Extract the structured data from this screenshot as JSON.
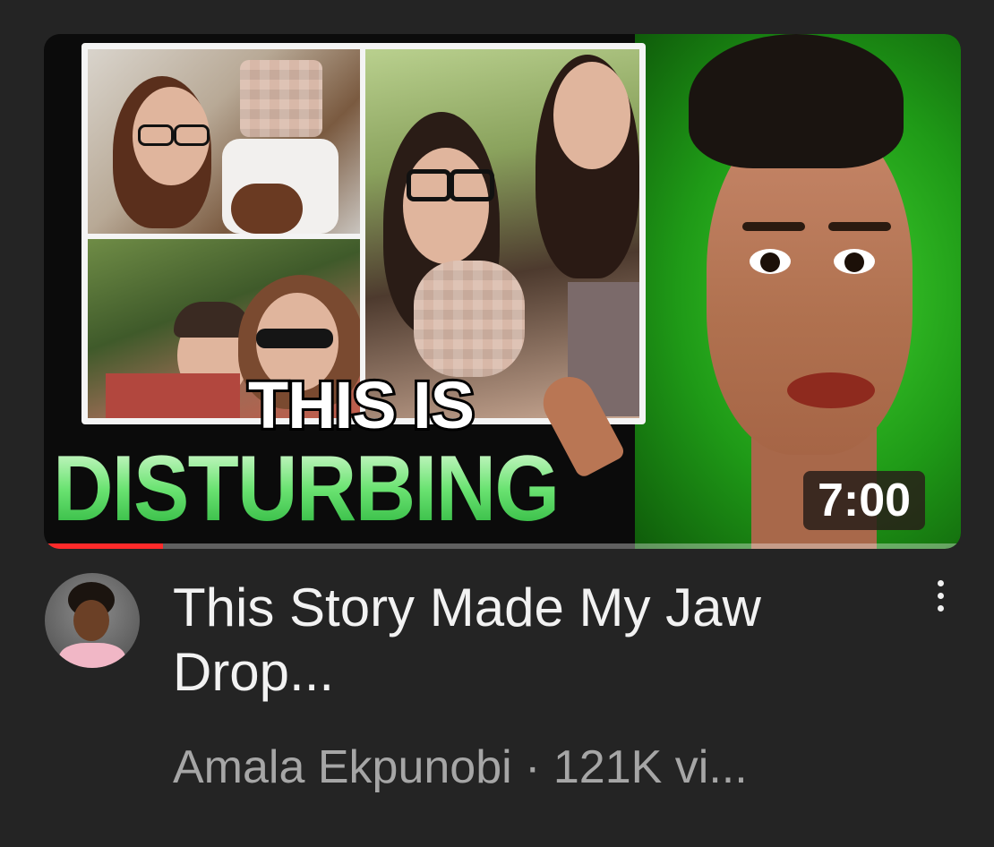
{
  "video": {
    "thumbnail": {
      "headline_line1": "THIS IS",
      "headline_line2": "DISTURBING",
      "duration": "7:00",
      "watch_progress": 0.13
    },
    "title": "This Story Made My Jaw Drop...",
    "meta": "Amala Ekpunobi · 121K vi...",
    "channel_avatar_icon": "channel-avatar",
    "menu_icon": "more-vert-icon"
  },
  "colors": {
    "background": "#242424",
    "headline_green": "#4bd65e",
    "progress_red": "#ff2a2a",
    "title_text": "#f2f2f2",
    "meta_text": "#a6a6a6"
  }
}
